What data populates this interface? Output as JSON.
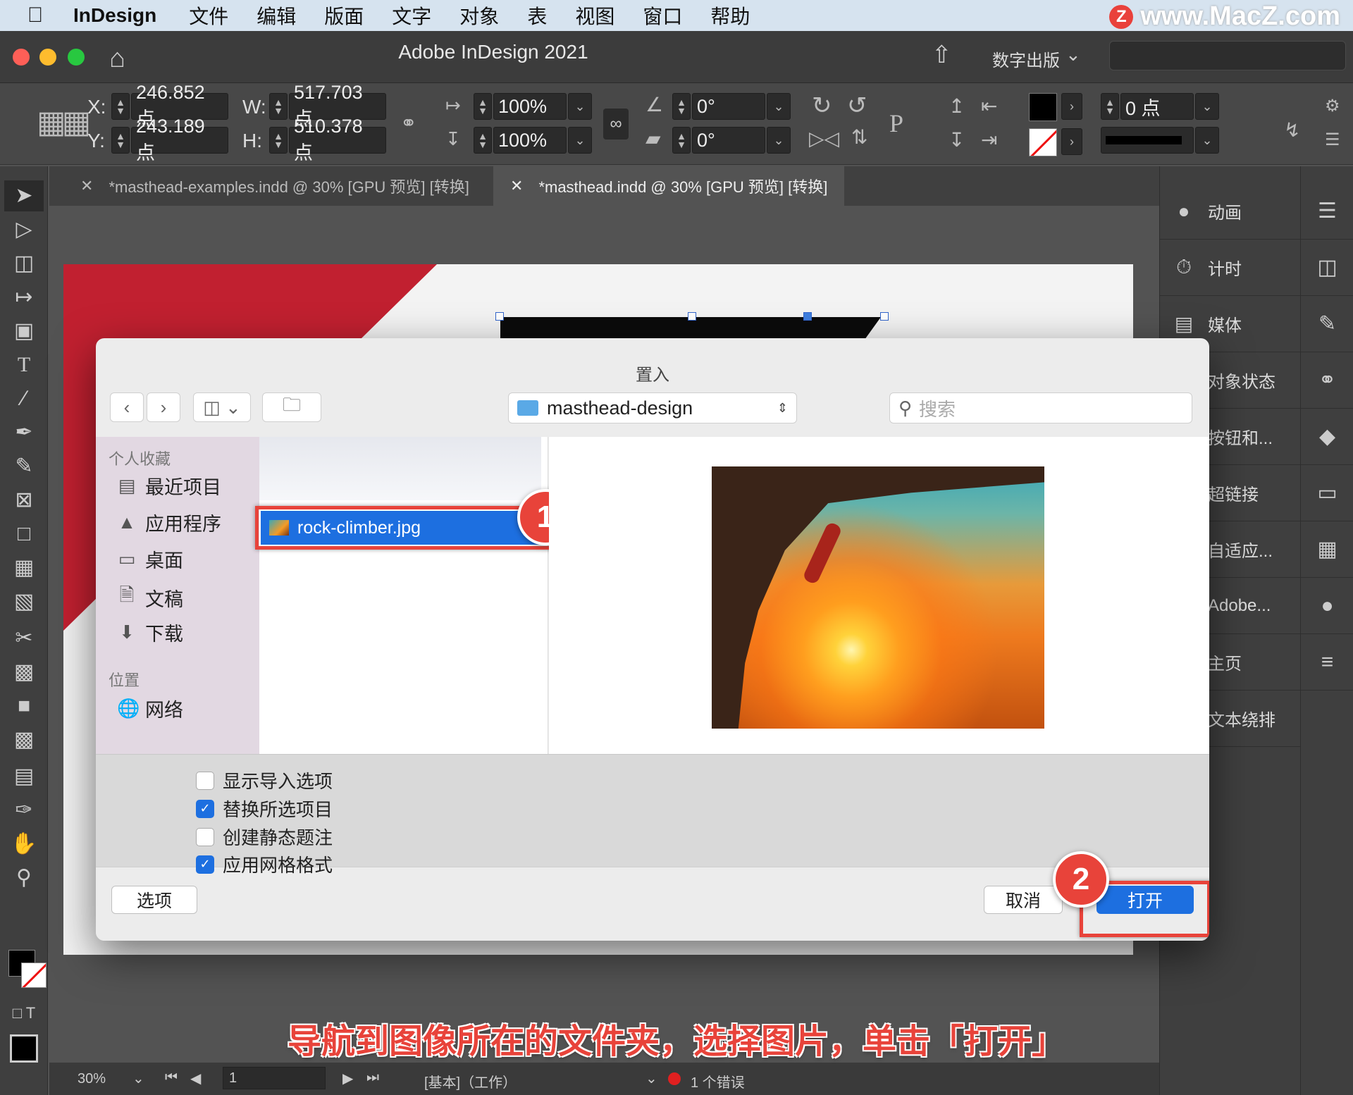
{
  "menubar": {
    "app_name": "InDesign",
    "items": [
      "文件",
      "编辑",
      "版面",
      "文字",
      "对象",
      "表",
      "视图",
      "窗口",
      "帮助"
    ],
    "watermark": "www.MacZ.com",
    "watermark_letter": "Z"
  },
  "titlebar": {
    "title": "Adobe InDesign 2021",
    "workspace": "数字出版"
  },
  "controls": {
    "x_label": "X:",
    "x_value": "246.852 点",
    "y_label": "Y:",
    "y_value": "243.189 点",
    "w_label": "W:",
    "w_value": "517.703 点",
    "h_label": "H:",
    "h_value": "510.378 点",
    "scale_x": "100%",
    "scale_y": "100%",
    "rotate": "0°",
    "shear": "0°",
    "stroke_weight": "0 点"
  },
  "tabs": [
    {
      "label": "*masthead-examples.indd @ 30% [GPU 预览] [转换]"
    },
    {
      "label": "*masthead.indd @ 30% [GPU 预览] [转换]"
    }
  ],
  "right_panel": [
    {
      "label": "动画",
      "icon": "animation-icon"
    },
    {
      "label": "计时",
      "icon": "timer-icon"
    },
    {
      "label": "媒体",
      "icon": "media-icon"
    },
    {
      "label": "对象状态",
      "icon": "object-states-icon"
    },
    {
      "label": "按钮和...",
      "icon": "buttons-icon"
    },
    {
      "label": "超链接",
      "icon": "hyperlinks-icon"
    },
    {
      "label": "自适应...",
      "icon": "liquid-layout-icon"
    },
    {
      "label": "Adobe...",
      "icon": "adobe-color-icon"
    },
    {
      "label": "主页",
      "icon": "pages-icon"
    },
    {
      "label": "文本绕排",
      "icon": "text-wrap-icon"
    }
  ],
  "dialog": {
    "title": "置入",
    "path": "masthead-design",
    "search_placeholder": "搜索",
    "sidebar_favorites_heading": "个人收藏",
    "sidebar_favorites": [
      {
        "label": "最近项目",
        "icon": "recents-icon"
      },
      {
        "label": "应用程序",
        "icon": "applications-icon"
      },
      {
        "label": "桌面",
        "icon": "desktop-icon"
      },
      {
        "label": "文稿",
        "icon": "documents-icon"
      },
      {
        "label": "下载",
        "icon": "downloads-icon"
      }
    ],
    "sidebar_locations_heading": "位置",
    "sidebar_locations": [
      {
        "label": "网络",
        "icon": "network-icon"
      }
    ],
    "selected_file": "rock-climber.jpg",
    "options": [
      {
        "label": "显示导入选项",
        "checked": false
      },
      {
        "label": "替换所选项目",
        "checked": true
      },
      {
        "label": "创建静态题注",
        "checked": false
      },
      {
        "label": "应用网格格式",
        "checked": true
      }
    ],
    "options_button": "选项",
    "cancel_button": "取消",
    "open_button": "打开"
  },
  "callouts": {
    "step1": "1",
    "step2": "2"
  },
  "statusbar": {
    "zoom": "30%",
    "page": "1",
    "profile": "[基本]（工作）",
    "errors": "1 个错误"
  },
  "caption": "导航到图像所在的文件夹，选择图片，单击「打开」"
}
